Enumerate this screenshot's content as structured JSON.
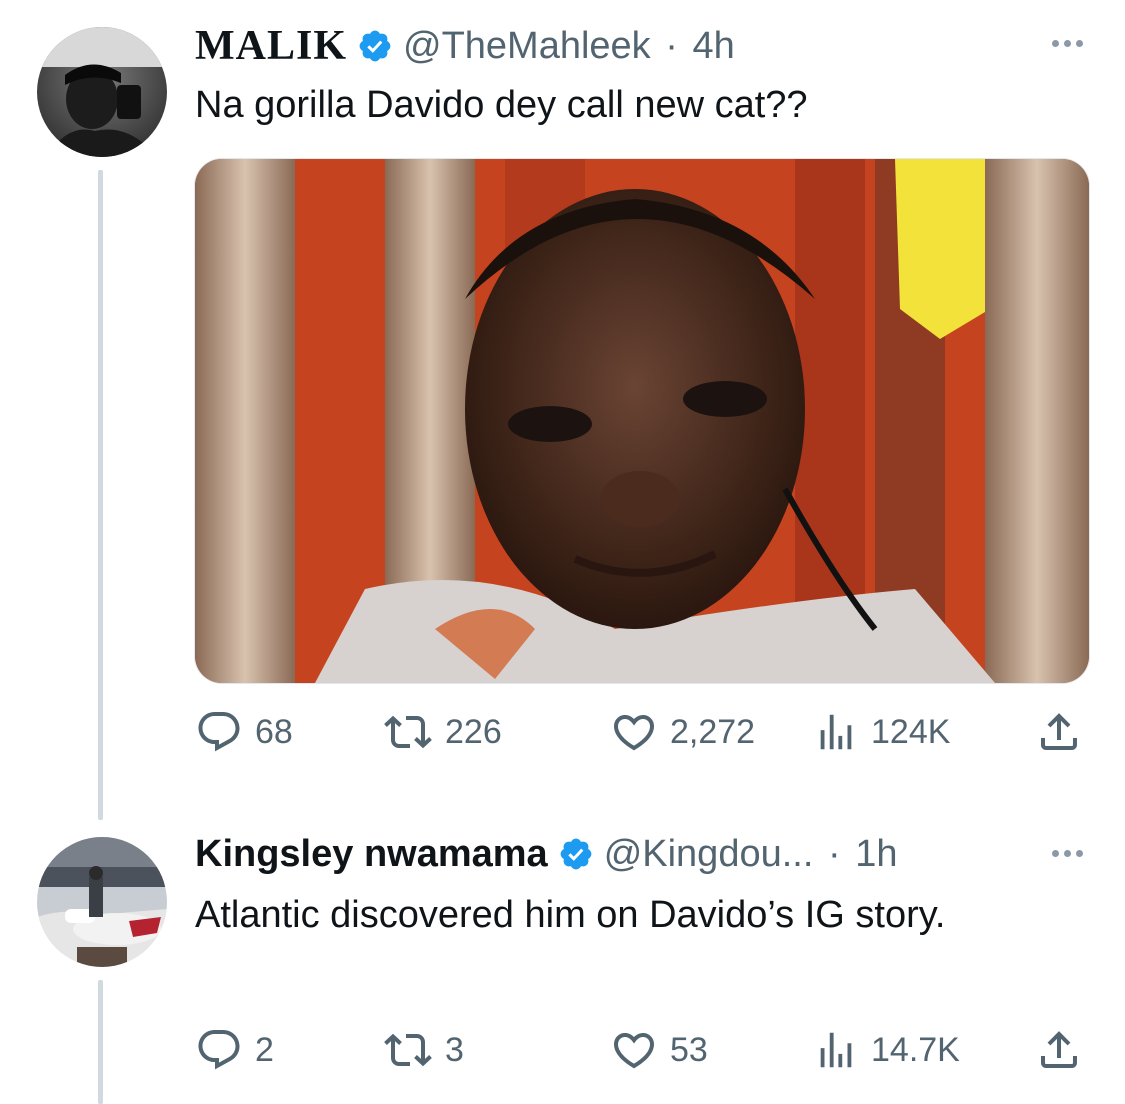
{
  "tweets": [
    {
      "display_name": "MALIK",
      "handle": "@TheMahleek",
      "separator": "·",
      "time": "4h",
      "text": "Na gorilla Davido dey call new cat??",
      "has_media": true,
      "replies": "68",
      "retweets": "226",
      "likes": "2,272",
      "views": "124K"
    },
    {
      "display_name": "Kingsley nwamama",
      "handle": "@Kingdou...",
      "separator": "·",
      "time": "1h",
      "text": "Atlantic discovered him on Davido’s IG story.",
      "has_media": false,
      "replies": "2",
      "retweets": "3",
      "likes": "53",
      "views": "14.7K"
    }
  ],
  "colors": {
    "verified_badge": "#1d9bf0",
    "secondary_text": "#536471",
    "thread_line": "#cfd9de"
  },
  "icons": [
    "verified-badge-icon",
    "more-dots-icon",
    "reply-icon",
    "retweet-icon",
    "like-icon",
    "views-icon",
    "share-icon"
  ]
}
